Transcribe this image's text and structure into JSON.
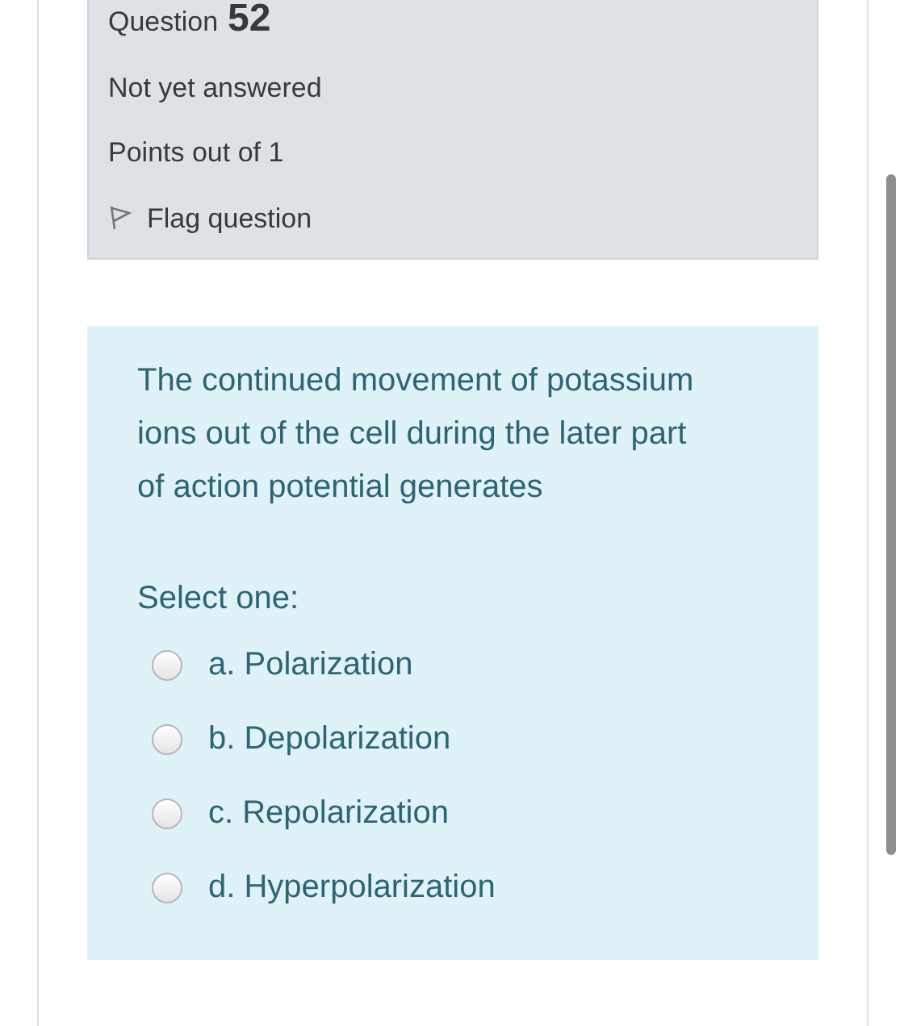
{
  "info": {
    "label": "Question",
    "number": "52",
    "status": "Not yet answered",
    "points": "Points out of 1",
    "flag": {
      "label": "Flag question",
      "flagged": false
    }
  },
  "question": {
    "text": "The continued movement of potassium ions out of the cell during the later part of action potential generates",
    "prompt": "Select one:",
    "options": [
      {
        "label": "a. Polarization",
        "selected": false
      },
      {
        "label": "b. Depolarization",
        "selected": false
      },
      {
        "label": "c. Repolarization",
        "selected": false
      },
      {
        "label": "d. Hyperpolarization",
        "selected": false
      }
    ]
  }
}
